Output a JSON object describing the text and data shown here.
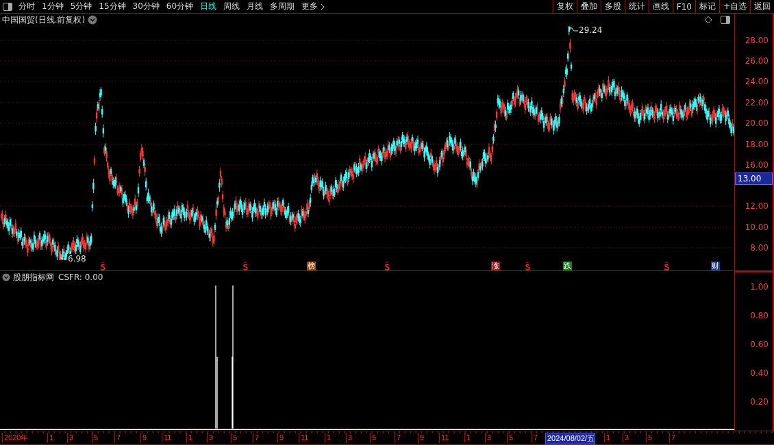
{
  "toolbar": {
    "periods": [
      {
        "label": "分时",
        "selected": false
      },
      {
        "label": "1分钟",
        "selected": false
      },
      {
        "label": "5分钟",
        "selected": false
      },
      {
        "label": "15分钟",
        "selected": false
      },
      {
        "label": "30分钟",
        "selected": false
      },
      {
        "label": "60分钟",
        "selected": false
      },
      {
        "label": "日线",
        "selected": true
      },
      {
        "label": "周线",
        "selected": false
      },
      {
        "label": "月线",
        "selected": false
      },
      {
        "label": "多周期",
        "selected": false
      },
      {
        "label": "更多",
        "selected": false
      }
    ],
    "actions": [
      "复权",
      "叠加",
      "多股",
      "统计",
      "画线",
      "F10",
      "标记",
      "+自选",
      "返回"
    ]
  },
  "main_chart": {
    "title": "中国国贸(日线.前复权)",
    "high_label": "29.24",
    "low_label": "6.98",
    "current_price": "13.00",
    "price_ticks": [
      "28.00",
      "26.00",
      "24.00",
      "22.00",
      "20.00",
      "18.00",
      "16.00",
      "12.00",
      "10.00",
      "8.00"
    ],
    "markers": [
      {
        "kind": "dollar"
      },
      {
        "kind": "dollar"
      },
      {
        "kind": "badge",
        "text": "榜",
        "color": "#8b4a12"
      },
      {
        "kind": "dollar"
      },
      {
        "kind": "badge",
        "text": "涨",
        "color": "#8b1a1a"
      },
      {
        "kind": "dollar"
      },
      {
        "kind": "badge",
        "text": "跌",
        "color": "#1a7a1a"
      },
      {
        "kind": "dollar"
      },
      {
        "kind": "badge",
        "text": "财",
        "color": "#1f3f7f"
      }
    ]
  },
  "indicator": {
    "name": "股朋指标网",
    "reading": "CSFR: 0.00",
    "ticks": [
      "1.00",
      "0.80",
      "0.60",
      "0.40",
      "0.20"
    ]
  },
  "date_axis": {
    "labels": [
      {
        "text": "2020年",
        "selected": false
      },
      {
        "text": "1",
        "selected": false
      },
      {
        "text": "3",
        "selected": false
      },
      {
        "text": "5",
        "selected": false
      },
      {
        "text": "7",
        "selected": false
      },
      {
        "text": "9",
        "selected": false
      },
      {
        "text": "11",
        "selected": false
      },
      {
        "text": "1",
        "selected": false
      },
      {
        "text": "3",
        "selected": false
      },
      {
        "text": "5",
        "selected": false
      },
      {
        "text": "7",
        "selected": false
      },
      {
        "text": "9",
        "selected": false
      },
      {
        "text": "11",
        "selected": false
      },
      {
        "text": "1",
        "selected": false
      },
      {
        "text": "3",
        "selected": false
      },
      {
        "text": "5",
        "selected": false
      },
      {
        "text": "7",
        "selected": false
      },
      {
        "text": "9",
        "selected": false
      },
      {
        "text": "11",
        "selected": false
      },
      {
        "text": "1",
        "selected": false
      },
      {
        "text": "3",
        "selected": false
      },
      {
        "text": "5",
        "selected": false
      },
      {
        "text": "7",
        "selected": false
      },
      {
        "text": "2024/08/02/五",
        "selected": true
      },
      {
        "text": "1",
        "selected": false
      },
      {
        "text": "3",
        "selected": false
      },
      {
        "text": "5",
        "selected": false
      },
      {
        "text": "7",
        "selected": false
      }
    ]
  }
}
